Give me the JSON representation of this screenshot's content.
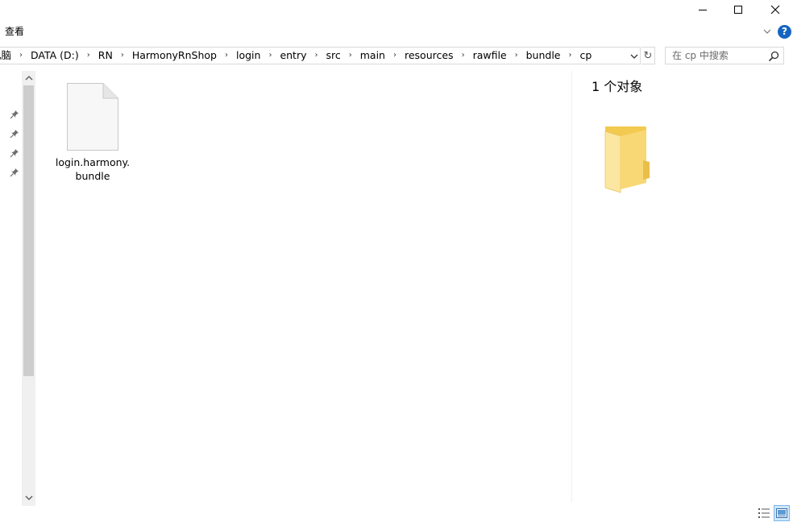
{
  "window": {
    "minimize_icon": "minimize-icon",
    "maximize_icon": "maximize-icon",
    "close_icon": "close-icon"
  },
  "ribbon": {
    "tab_view": "查看",
    "expand_icon": "chevron-down-icon",
    "help_icon": "help-icon",
    "help_label": "?"
  },
  "address_bar": {
    "crumbs": [
      "电脑",
      "DATA (D:)",
      "RN",
      "HarmonyRnShop",
      "login",
      "entry",
      "src",
      "main",
      "resources",
      "rawfile",
      "bundle",
      "cp"
    ],
    "separator": "›",
    "refresh_label": "↻"
  },
  "search": {
    "placeholder": "在 cp 中搜索"
  },
  "files": [
    {
      "name": "login.harmony.bundle",
      "label_line1": "login.harmony.",
      "label_line2": "bundle",
      "icon": "generic-file-icon"
    }
  ],
  "preview": {
    "item_count": "1 个对象",
    "icon": "folder-icon"
  },
  "status_bar": {
    "details_view_icon": "details-view-icon",
    "large_icons_view_icon": "large-icons-view-icon",
    "active_view": "large-icons"
  },
  "colors": {
    "help_blue": "#1565c0",
    "scrollbar_thumb": "#cdcdcd",
    "folder_yellow": "#f8d775",
    "active_view_bg": "#cce8ff"
  }
}
